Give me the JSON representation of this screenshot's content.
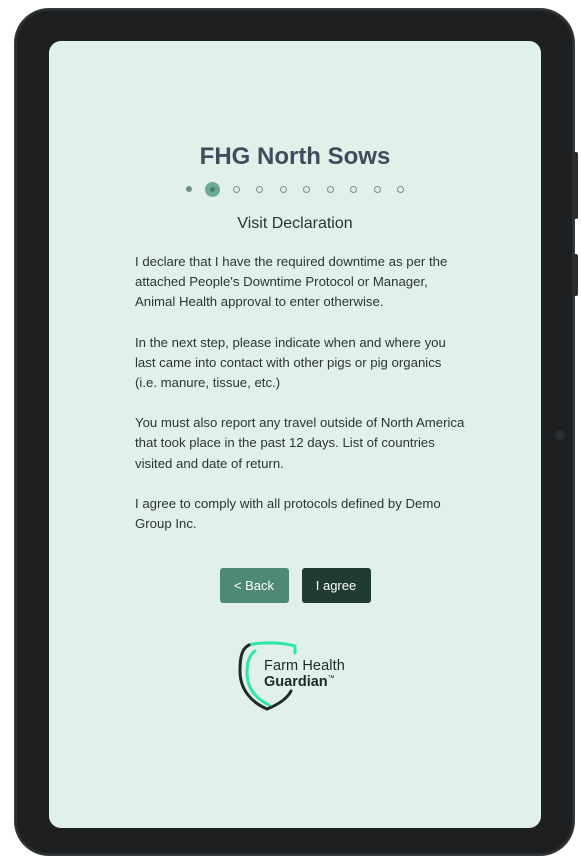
{
  "app": {
    "title": "FHG North Sows"
  },
  "progress": {
    "total_steps": 10,
    "current_step": 2
  },
  "page": {
    "heading": "Visit Declaration",
    "paragraphs": [
      "I declare that I have the required downtime as per the attached People's Downtime Protocol or Manager, Animal Health approval to enter otherwise.",
      "In the next step, please indicate when and where you last came into contact with other pigs or pig organics (i.e. manure, tissue, etc.)",
      "You must also report any travel outside of North America that took place in the past 12 days. List of countries visited and date of return.",
      "I agree to comply with all protocols defined by Demo Group Inc."
    ]
  },
  "actions": {
    "back_label": "< Back",
    "agree_label": "I agree"
  },
  "brand": {
    "line1": "Farm Health",
    "line2": "Guardian",
    "trademark": "™",
    "accent_color": "#2ee6a8",
    "icon": "shield-logo-icon"
  },
  "colors": {
    "screen_background": "#e2f0ea",
    "back_button": "#4e8977",
    "agree_button": "#1f3b33",
    "title_text": "#404b5c"
  }
}
